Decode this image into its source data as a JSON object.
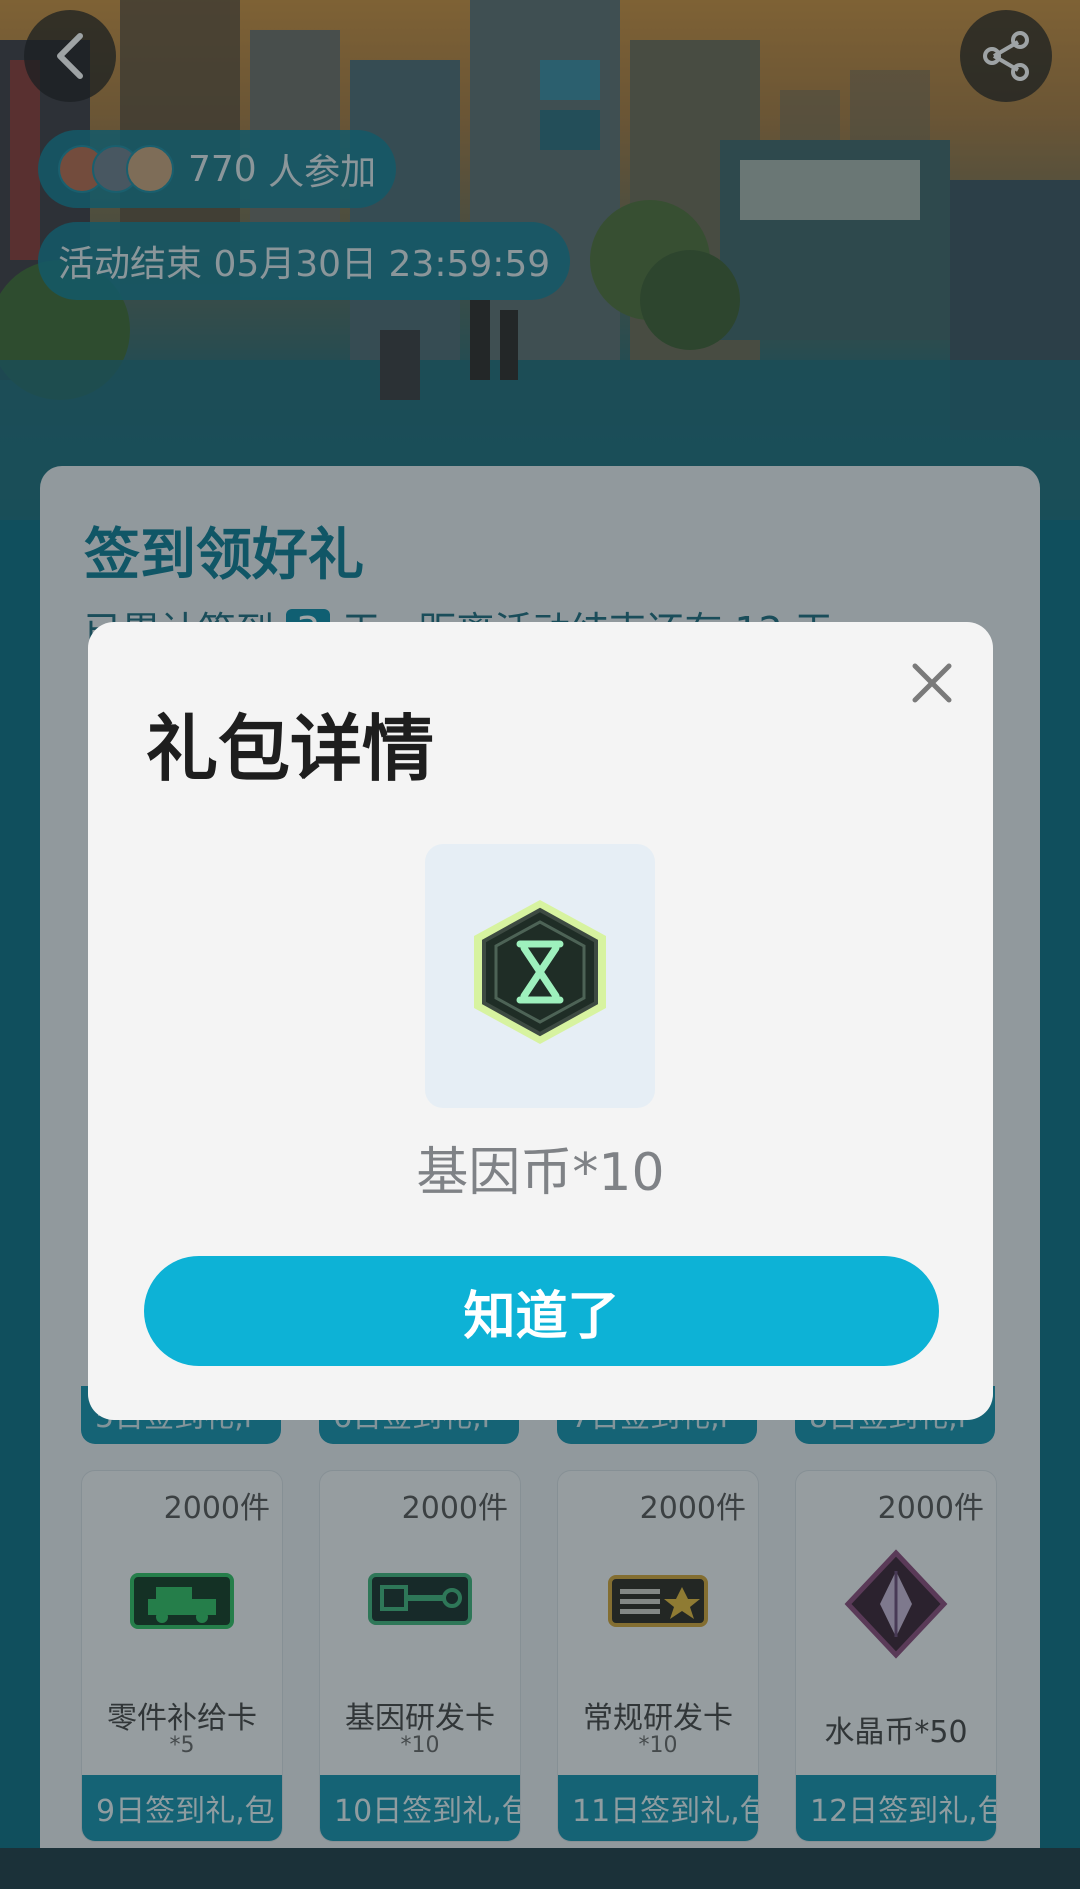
{
  "header": {
    "participants_count": "770",
    "participants_suffix": " 人参加",
    "event_end_text": "活动结束 05月30日 23:59:59"
  },
  "checkin": {
    "title": "签到领好礼",
    "sub_prefix": "已累计签到 ",
    "days_done": "3",
    "sub_suffix": " 天，距离活动结束还有 12 天"
  },
  "row_partial_labels": [
    "5日签到礼,i",
    "6日签到礼,i",
    "7日签到礼,i",
    "8日签到礼,i"
  ],
  "rewards": [
    {
      "count": "2000件",
      "name": "零件补给卡",
      "name_extra": "*5",
      "footer": "9日签到礼,包",
      "icon": "car-card-icon",
      "color": "#2fbf62"
    },
    {
      "count": "2000件",
      "name": "基因研发卡",
      "name_extra": "*10",
      "footer": "10日签到礼,包",
      "icon": "key-card-icon",
      "color": "#3fb47a"
    },
    {
      "count": "2000件",
      "name": "常规研发卡",
      "name_extra": "*10",
      "footer": "11日签到礼,包",
      "icon": "research-card-icon",
      "color": "#d0a437"
    },
    {
      "count": "2000件",
      "name": "水晶币*50",
      "name_extra": "",
      "footer": "12日签到礼,包",
      "icon": "crystal-coin-icon",
      "color": "#8a4a7a"
    }
  ],
  "modal": {
    "title": "礼包详情",
    "item_label": "基因币*10",
    "item_icon": "gene-coin-icon",
    "confirm_label": "知道了"
  }
}
